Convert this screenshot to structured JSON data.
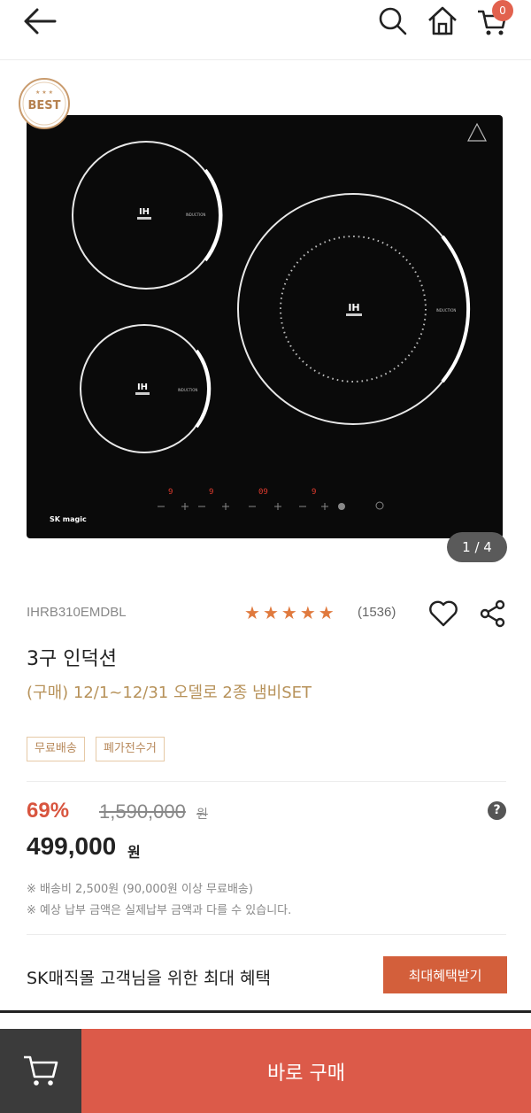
{
  "header": {
    "cart_count": "0"
  },
  "gallery": {
    "best_label": "BEST",
    "brand_label": "SK magic",
    "ih_label": "IH",
    "induction_label": "INDUCTION",
    "pager": "1 / 4"
  },
  "product": {
    "model": "IHRB310EMDBL",
    "rating_stars": 5,
    "review_count": "(1536)",
    "title": "3구 인덕션",
    "subtitle": "(구매) 12/1~12/31 오델로 2종 냄비SET",
    "tags": [
      "무료배송",
      "폐가전수거"
    ]
  },
  "pricing": {
    "discount": "69%",
    "original_price": "1,590,000",
    "original_unit": "원",
    "price": "499,000",
    "price_unit": "원",
    "help": "?",
    "notes": [
      "※ 배송비 2,500원 (90,000원 이상 무료배송)",
      "※ 예상 납부 금액은 실제납부 금액과 다를 수 있습니다."
    ]
  },
  "benefit": {
    "text": "SK매직몰 고객님을 위한 최대 혜택",
    "button": "최대혜택받기"
  },
  "bottom": {
    "buy_label": "바로 구매"
  },
  "colors": {
    "accent": "#dc5a49",
    "star": "#e07a3e",
    "tag_text": "#b7885a",
    "subtitle": "#b7925a"
  }
}
